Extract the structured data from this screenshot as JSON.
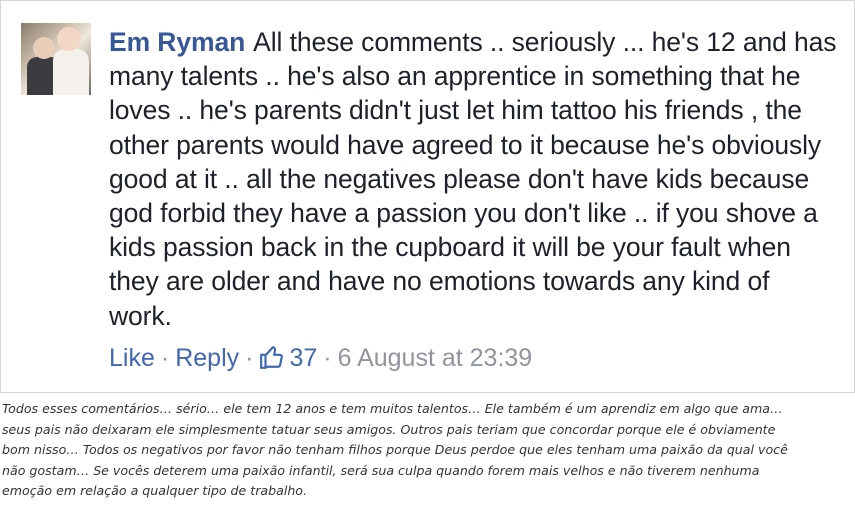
{
  "comment": {
    "author": "Em Ryman",
    "text": "All these comments .. seriously ... he's 12 and has many talents .. he's also an apprentice in something that he loves .. he's parents didn't just let him tattoo his friends , the other parents would have agreed to it because he's obviously good at it .. all the negatives please don't have kids because god forbid they have a passion you don't like .. if you shove a kids passion back in the cupboard it will be your fault when they are older and have no emotions towards any kind of work.",
    "actions": {
      "like_label": "Like",
      "separator": "·",
      "reply_label": "Reply",
      "like_count": "37",
      "timestamp": "6 August at 23:39"
    },
    "avatar_icon": "avatar-photo",
    "like_icon": "thumbs-up-icon",
    "link_color": "#4267b2",
    "author_color": "#365899"
  },
  "caption": {
    "text": "Todos esses comentários… sério… ele tem 12 anos e tem muitos talentos… Ele também é um aprendiz em algo que ama…\nseus pais não deixaram ele simplesmente tatuar seus amigos. Outros pais teriam que concordar porque ele é obviamente\nbom nisso… Todos os negativos por favor não tenham filhos porque Deus perdoe que eles tenham uma paixão da qual você\nnão gostam… Se vocês deterem uma paixão infantil, será sua culpa quando forem mais velhos e não tiverem nenhuma\nemoção em relação a qualquer tipo de trabalho."
  }
}
